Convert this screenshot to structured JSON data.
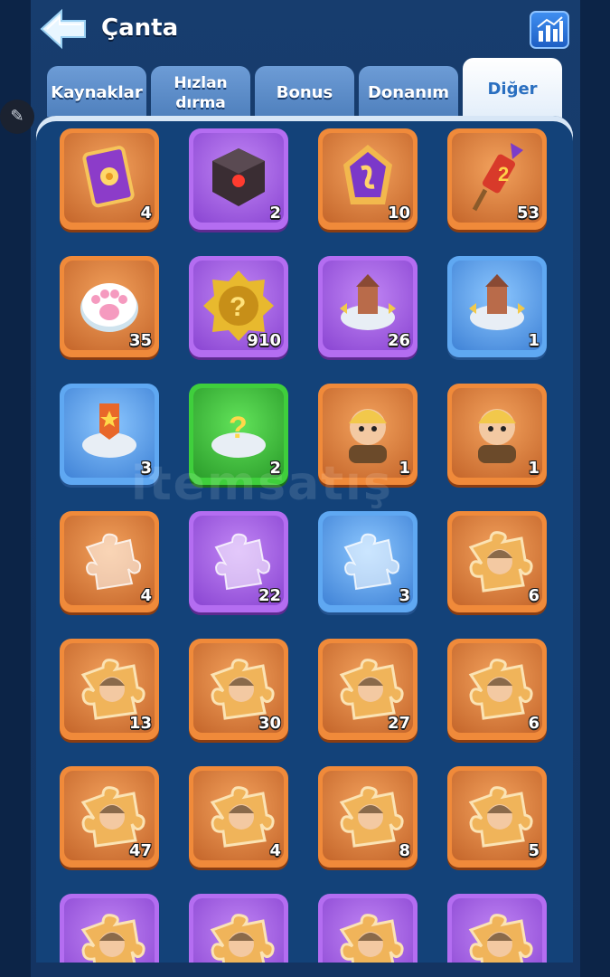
{
  "header": {
    "title": "Çanta",
    "back_icon": "back-arrow-icon",
    "stats_icon": "bar-chart-icon"
  },
  "tabs": [
    {
      "label": "Kaynaklar",
      "active": false
    },
    {
      "label": "Hızlan dırma",
      "active": false
    },
    {
      "label": "Bonus",
      "active": false
    },
    {
      "label": "Donanım",
      "active": false
    },
    {
      "label": "Diğer",
      "active": true
    }
  ],
  "watermark": "itemsatış",
  "items": [
    {
      "icon": "flower-card-icon",
      "rarity": "orange",
      "count": "4"
    },
    {
      "icon": "dark-crystal-cube-icon",
      "rarity": "purple",
      "count": "2"
    },
    {
      "icon": "rune-token-icon",
      "rarity": "orange",
      "count": "10"
    },
    {
      "icon": "firework-rocket-icon",
      "rarity": "orange",
      "count": "53"
    },
    {
      "icon": "paw-token-icon",
      "rarity": "orange",
      "count": "35"
    },
    {
      "icon": "mystery-gear-badge-icon",
      "rarity": "purple",
      "count": "910"
    },
    {
      "icon": "building-relocate-icon",
      "rarity": "purple",
      "count": "26"
    },
    {
      "icon": "building-relocate-icon",
      "rarity": "blue",
      "count": "1"
    },
    {
      "icon": "banner-relocate-icon",
      "rarity": "blue",
      "count": "3"
    },
    {
      "icon": "random-relocate-icon",
      "rarity": "green",
      "count": "2"
    },
    {
      "icon": "hero-portrait-icon",
      "rarity": "orange",
      "count": "1"
    },
    {
      "icon": "hero-portrait-icon",
      "rarity": "orange",
      "count": "1"
    },
    {
      "icon": "puzzle-piece-icon",
      "rarity": "orange",
      "count": "4"
    },
    {
      "icon": "puzzle-piece-icon",
      "rarity": "purple",
      "count": "22"
    },
    {
      "icon": "puzzle-piece-icon",
      "rarity": "blue",
      "count": "3"
    },
    {
      "icon": "hero-puzzle-icon",
      "rarity": "orange",
      "count": "6"
    },
    {
      "icon": "hero-puzzle-icon",
      "rarity": "orange",
      "count": "13"
    },
    {
      "icon": "hero-puzzle-icon",
      "rarity": "orange",
      "count": "30"
    },
    {
      "icon": "hero-puzzle-icon",
      "rarity": "orange",
      "count": "27"
    },
    {
      "icon": "hero-puzzle-icon",
      "rarity": "orange",
      "count": "6"
    },
    {
      "icon": "hero-puzzle-icon",
      "rarity": "orange",
      "count": "47"
    },
    {
      "icon": "hero-puzzle-icon",
      "rarity": "orange",
      "count": "4"
    },
    {
      "icon": "hero-puzzle-icon",
      "rarity": "orange",
      "count": "8"
    },
    {
      "icon": "hero-puzzle-icon",
      "rarity": "orange",
      "count": "5"
    },
    {
      "icon": "hero-puzzle-icon",
      "rarity": "purple",
      "count": ""
    },
    {
      "icon": "hero-puzzle-icon",
      "rarity": "purple",
      "count": ""
    },
    {
      "icon": "hero-puzzle-icon",
      "rarity": "purple",
      "count": ""
    },
    {
      "icon": "hero-puzzle-icon",
      "rarity": "purple",
      "count": ""
    }
  ]
}
